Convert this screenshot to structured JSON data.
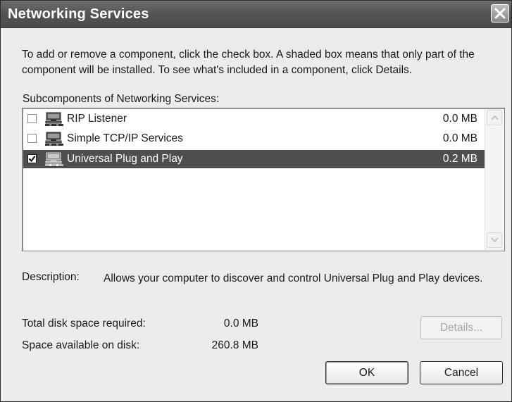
{
  "window": {
    "title": "Networking Services"
  },
  "dialog": {
    "intro": "To add or remove a component, click the check box. A shaded box means that only part of the component will be installed. To see what's included in a component, click Details.",
    "subcomponents_label": "Subcomponents of Networking Services:",
    "components": [
      {
        "label": "RIP Listener",
        "size": "0.0 MB",
        "checked": false,
        "selected": false,
        "icon": "network-computer-icon"
      },
      {
        "label": "Simple TCP/IP Services",
        "size": "0.0 MB",
        "checked": false,
        "selected": false,
        "icon": "network-computer-icon"
      },
      {
        "label": "Universal Plug and Play",
        "size": "0.2 MB",
        "checked": true,
        "selected": true,
        "icon": "network-computer-icon"
      }
    ],
    "description_label": "Description:",
    "description_text": "Allows your computer to discover and control Universal Plug and Play devices.",
    "total_disk_label": "Total disk space required:",
    "total_disk_value": "0.0 MB",
    "available_disk_label": "Space available on disk:",
    "available_disk_value": "260.8 MB",
    "buttons": {
      "details": "Details...",
      "ok": "OK",
      "cancel": "Cancel"
    }
  }
}
